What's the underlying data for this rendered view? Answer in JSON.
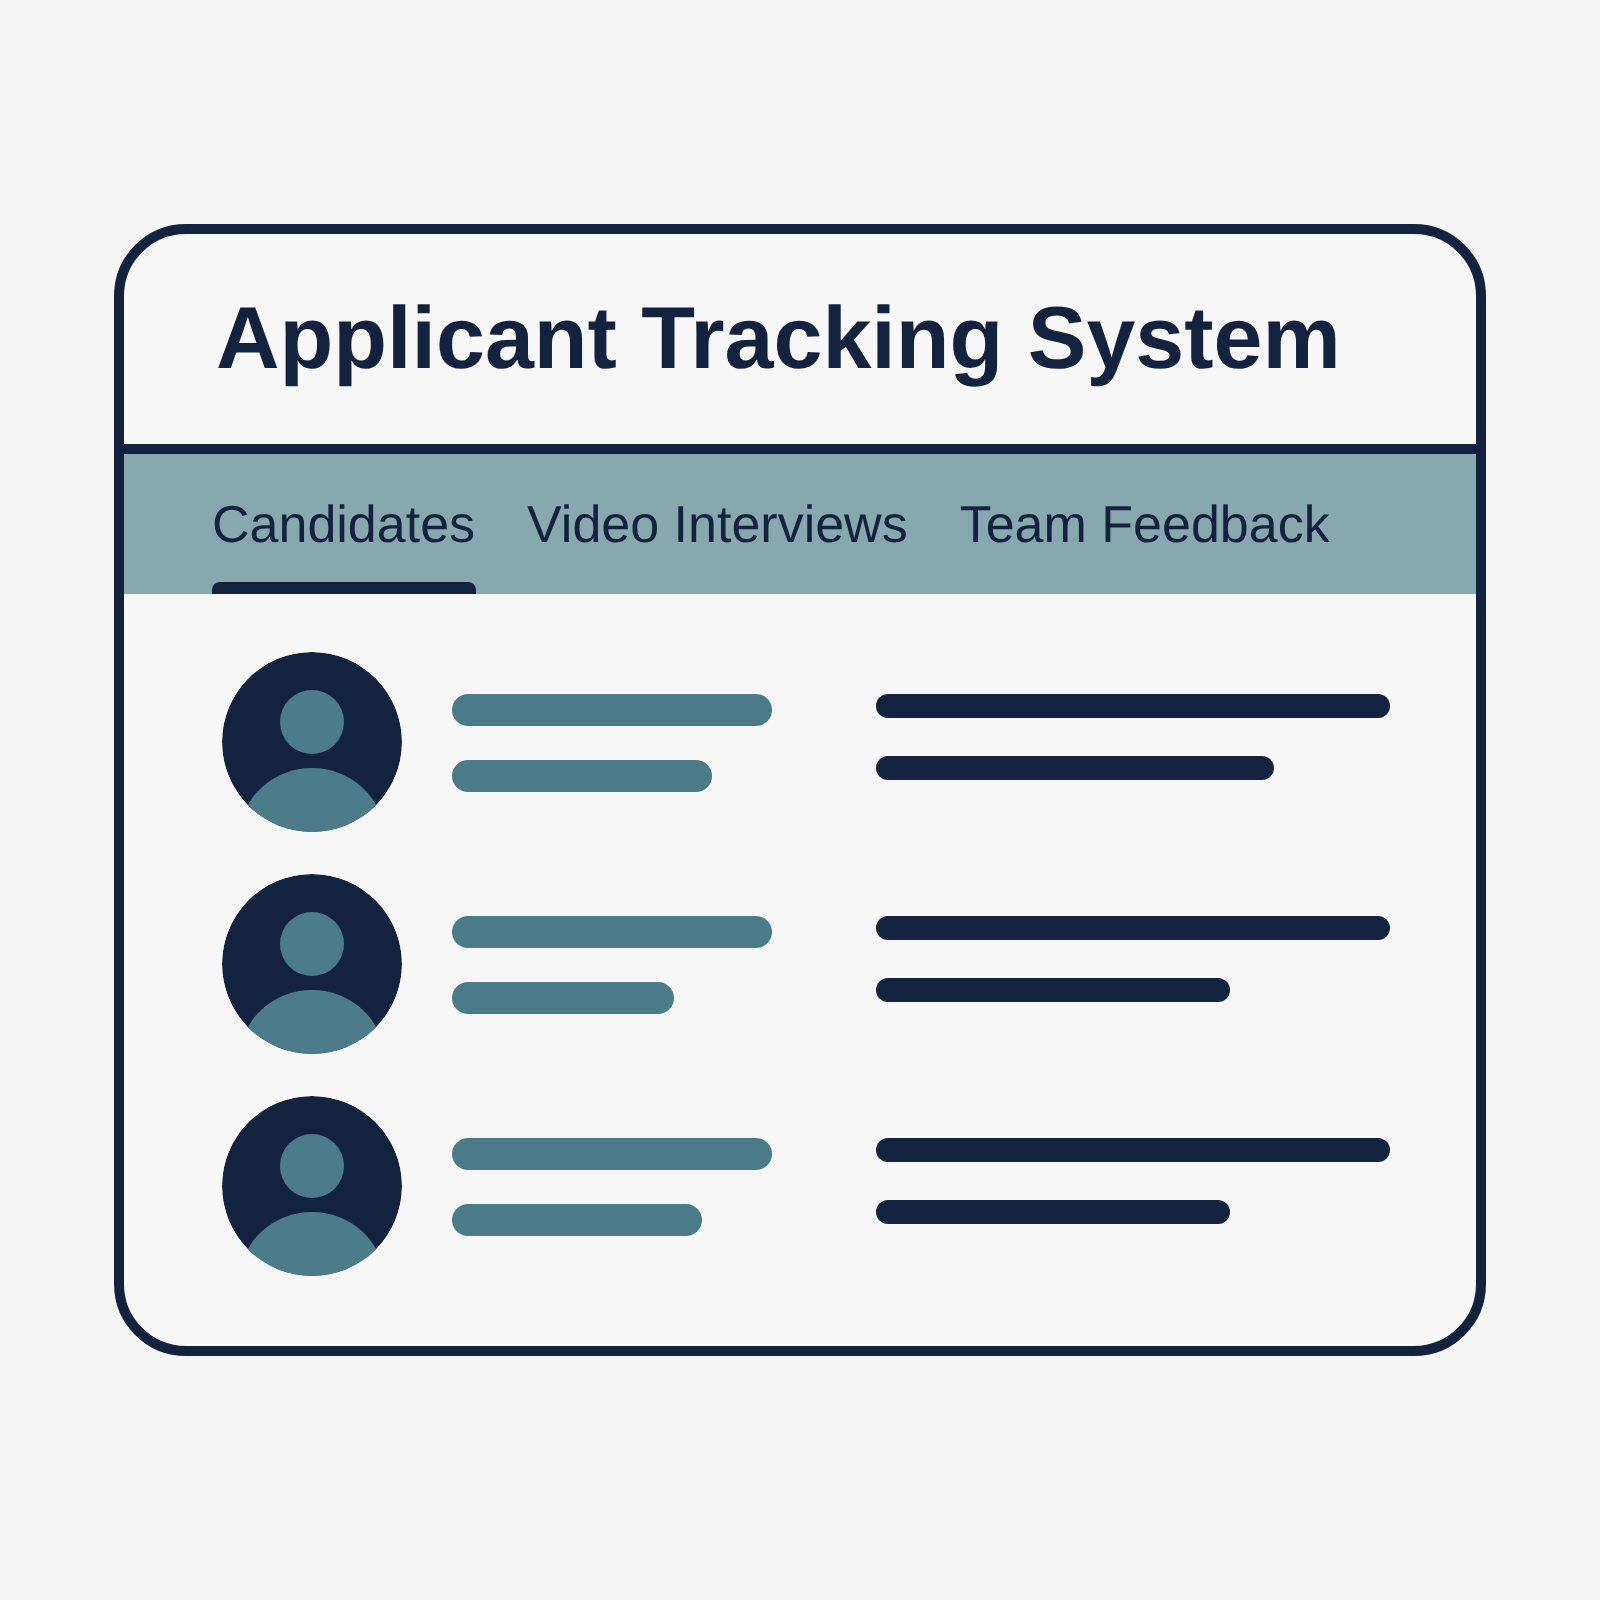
{
  "window": {
    "title": "Applicant Tracking System"
  },
  "tabs": [
    {
      "label": "Candidates",
      "selected": true
    },
    {
      "label": "Video Interviews",
      "selected": false
    },
    {
      "label": "Team Feedback",
      "selected": false
    }
  ]
}
